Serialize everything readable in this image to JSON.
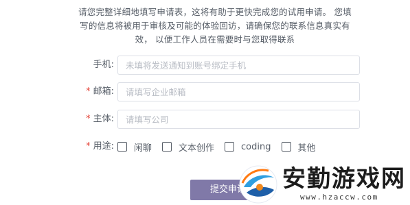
{
  "intro": {
    "line1": "请您完整详细地填写申请表，这将有助于更快完成您的试用申请。 您填",
    "line2": "写的信息将被用于审核及可能的体验回访，请确保您的联系信息真实有",
    "line3": "效， 以便工作人员在需要时与您取得联系"
  },
  "form": {
    "phone": {
      "label": "手机:",
      "required": false,
      "value": "",
      "placeholder": "未填将发送通知到账号绑定手机"
    },
    "email": {
      "label": "邮箱:",
      "required": true,
      "required_mark": "*",
      "value": "",
      "placeholder": "请填写企业邮箱"
    },
    "entity": {
      "label": "主体:",
      "required": true,
      "required_mark": "*",
      "value": "",
      "placeholder": "请填写公司"
    },
    "purpose": {
      "label": "用途:",
      "required": true,
      "required_mark": "*",
      "options": [
        {
          "label": "闲聊",
          "checked": false
        },
        {
          "label": "文本创作",
          "checked": false
        },
        {
          "label": "coding",
          "checked": false
        },
        {
          "label": "其他",
          "checked": false
        }
      ]
    },
    "submit_label": "提交申请"
  },
  "watermark": {
    "title": "安勤游戏网",
    "url": "www.hzaccw.com"
  },
  "colors": {
    "button_bg": "#8079a8",
    "required_mark": "#e5453a",
    "text": "#555c66",
    "border": "#dcdfe6"
  }
}
